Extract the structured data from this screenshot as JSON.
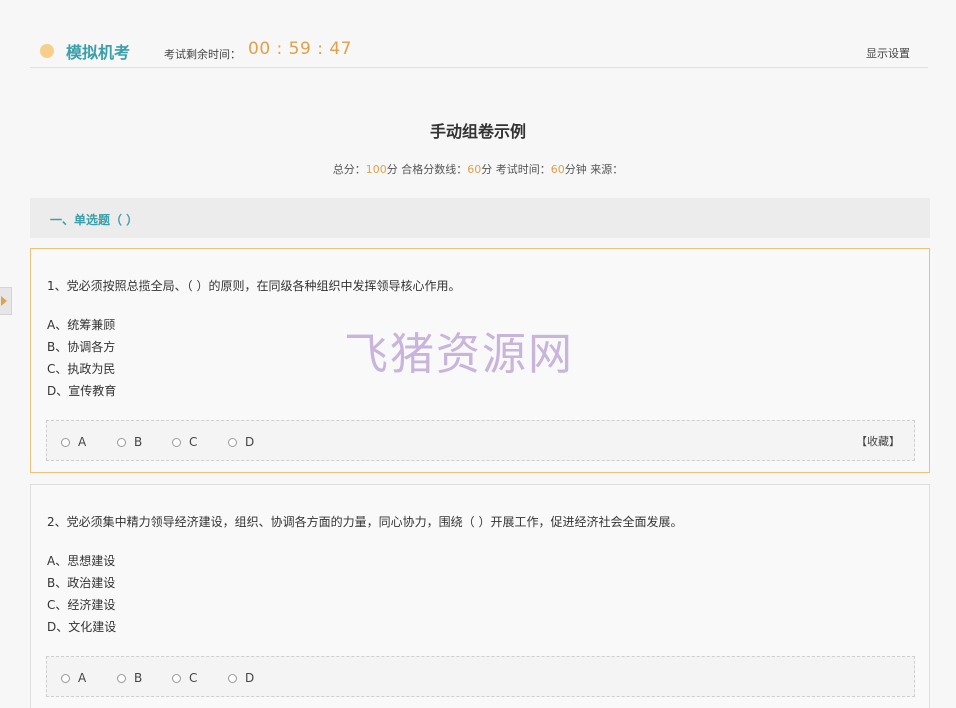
{
  "header": {
    "app_title": "模拟机考",
    "timer_label": "考试剩余时间：",
    "timer_value": "00 : 59 : 47",
    "display_settings": "显示设置"
  },
  "paper": {
    "title": "手动组卷示例",
    "meta": {
      "total_label": "总分：",
      "total_value": "100",
      "total_unit": "分 合格分数线：",
      "pass_value": "60",
      "pass_unit": "分 考试时间：",
      "time_value": "60",
      "time_unit": "分钟 来源："
    }
  },
  "section": {
    "title": "一、单选题（ ）"
  },
  "questions": [
    {
      "stem": "1、党必须按照总揽全局、（ ）的原则，在同级各种组织中发挥领导核心作用。",
      "options": [
        "A、统筹兼顾",
        "B、协调各方",
        "C、执政为民",
        "D、宣传教育"
      ],
      "choices": [
        "A",
        "B",
        "C",
        "D"
      ],
      "favorite": "【收藏】"
    },
    {
      "stem": "2、党必须集中精力领导经济建设，组织、协调各方面的力量，同心协力，围绕（ ）开展工作，促进经济社会全面发展。",
      "options": [
        "A、思想建设",
        "B、政治建设",
        "C、经济建设",
        "D、文化建设"
      ],
      "choices": [
        "A",
        "B",
        "C",
        "D"
      ]
    }
  ],
  "watermark": "飞猪资源网",
  "colors": {
    "accent_teal": "#3a9fa9",
    "accent_orange": "#e0a14a",
    "active_border": "#edc17a"
  }
}
